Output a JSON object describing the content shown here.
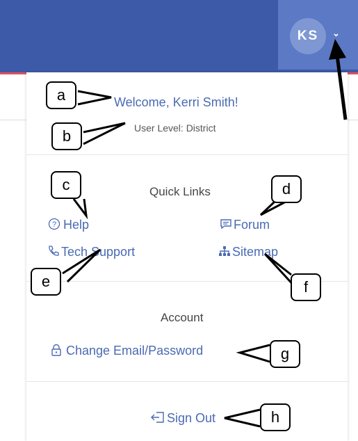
{
  "header": {
    "avatar_initials": "KS",
    "caret_glyph": "⌄"
  },
  "menu": {
    "welcome": "Welcome, Kerri Smith!",
    "user_level": "User Level: District",
    "quick_links_heading": "Quick Links",
    "help_label": "Help",
    "forum_label": "Forum",
    "tech_support_label": "Tech Support",
    "sitemap_label": "Sitemap",
    "account_heading": "Account",
    "change_email_label": "Change Email/Password",
    "sign_out_label": "Sign Out"
  },
  "icons": {
    "help": "help-circle-icon",
    "forum": "chat-bubble-icon",
    "tech_support": "phone-icon",
    "sitemap": "sitemap-icon",
    "change_email": "lock-icon",
    "sign_out": "sign-out-icon"
  },
  "callouts": {
    "a": "a",
    "b": "b",
    "c": "c",
    "d": "d",
    "e": "e",
    "f": "f",
    "g": "g",
    "h": "h"
  },
  "colors": {
    "header_bg": "#3d5aa8",
    "avatar_bg": "#7f98d4",
    "link": "#4a6ab3",
    "accent_line": "#e0515c"
  }
}
